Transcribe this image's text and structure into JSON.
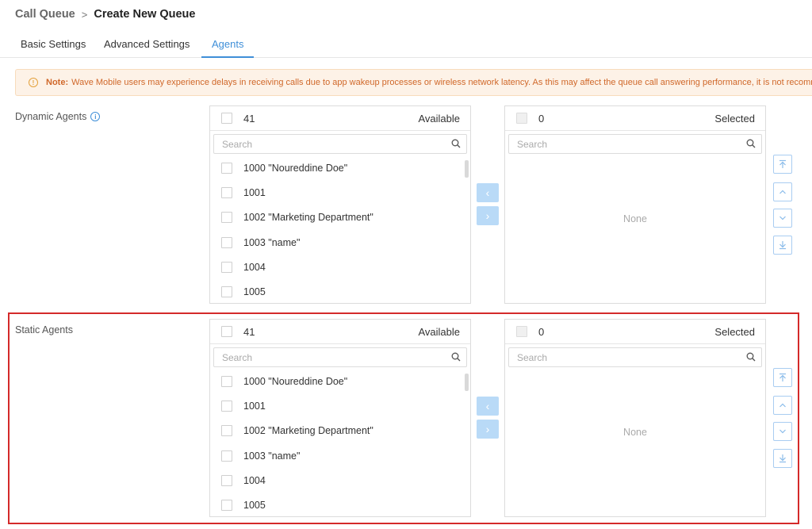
{
  "breadcrumb": {
    "parent": "Call Queue",
    "separator": ">",
    "current": "Create New Queue"
  },
  "tabs": [
    "Basic Settings",
    "Advanced Settings",
    "Agents"
  ],
  "note": {
    "label": "Note:",
    "text": "Wave Mobile users may experience delays in receiving calls due to app wakeup processes or wireless network latency. As this may affect the queue call answering performance, it is not recommended"
  },
  "dynamic": {
    "label": "Dynamic Agents",
    "available": {
      "count": "41",
      "title": "Available",
      "search_placeholder": "Search",
      "items": [
        "1000 \"Noureddine Doe\"",
        "1001",
        "1002 \"Marketing Department\"",
        "1003 \"name\"",
        "1004",
        "1005"
      ]
    },
    "selected": {
      "count": "0",
      "title": "Selected",
      "search_placeholder": "Search",
      "empty": "None"
    }
  },
  "static": {
    "label": "Static Agents",
    "available": {
      "count": "41",
      "title": "Available",
      "search_placeholder": "Search",
      "items": [
        "1000 \"Noureddine Doe\"",
        "1001",
        "1002 \"Marketing Department\"",
        "1003 \"name\"",
        "1004",
        "1005"
      ]
    },
    "selected": {
      "count": "0",
      "title": "Selected",
      "search_placeholder": "Search",
      "empty": "None"
    }
  },
  "buttons": {
    "move_left": "‹",
    "move_right": "›"
  },
  "colors": {
    "accent": "#3f8fd8",
    "warning": "#d0682a",
    "highlight": "#d42a2a"
  }
}
